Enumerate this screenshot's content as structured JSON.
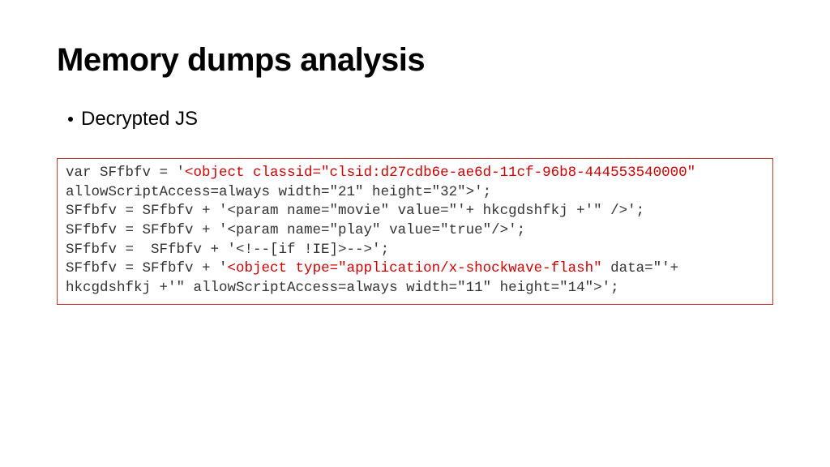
{
  "title": "Memory dumps analysis",
  "bullet": "Decrypted JS",
  "code": {
    "l1a": "var SFfbfv = '",
    "l1b": "<object classid=\"clsid:d27cdb6e-ae6d-11cf-96b8-444553540000\"",
    "l2": "allowScriptAccess=always width=\"21\" height=\"32\">';",
    "l3": "SFfbfv = SFfbfv + '<param name=\"movie\" value=\"'+ hkcgdshfkj +'\" />';",
    "l4": "SFfbfv = SFfbfv + '<param name=\"play\" value=\"true\"/>';",
    "l5": "SFfbfv =  SFfbfv + '<!--[if !IE]>-->';",
    "l6a": "SFfbfv = SFfbfv + '",
    "l6b": "<object type=\"application/x-shockwave-flash\"",
    "l6c": " data=\"'+",
    "l7": "hkcgdshfkj +'\" allowScriptAccess=always width=\"11\" height=\"14\">';"
  }
}
